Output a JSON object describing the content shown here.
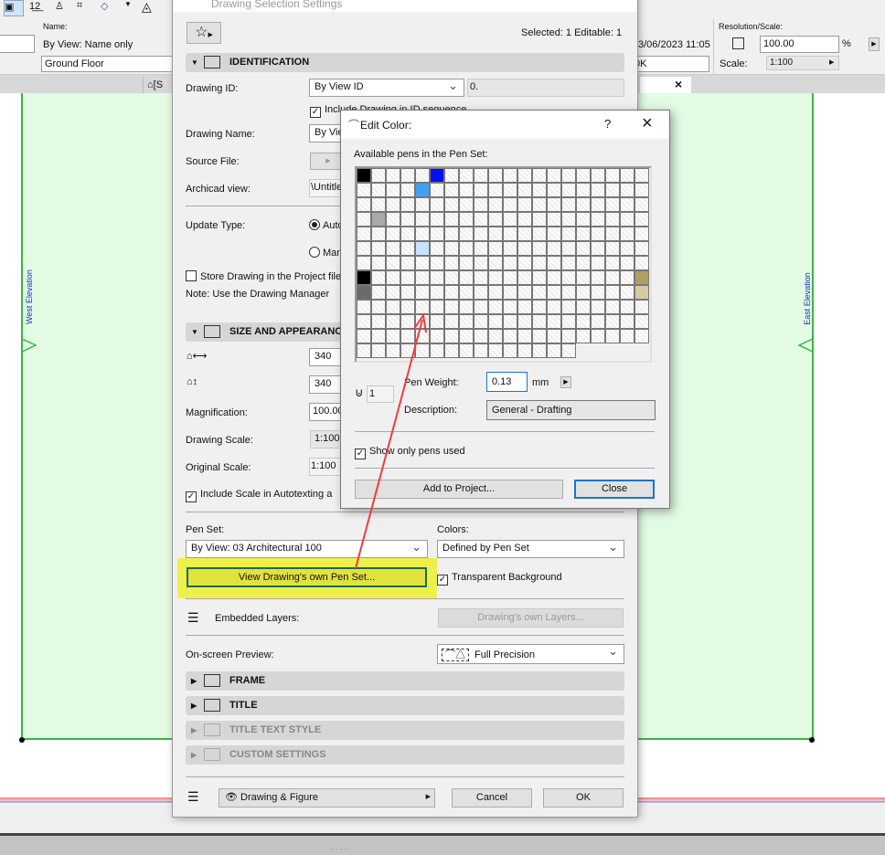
{
  "toolbar": {
    "icons": [
      "selection-icon",
      "numbering-icon",
      "figure-icon",
      "drawing-icon",
      "fill-icon",
      "dropdown-icon",
      "circle-icon"
    ]
  },
  "infobox": {
    "name_label": "Name:",
    "name_value": "By View: Name only",
    "layer_value": "Ground Floor",
    "date_value": "3/06/2023 11:05",
    "status_value": "0K",
    "resolution_label": "Resolution/Scale:",
    "resolution_value": "100.00",
    "percent": "%",
    "scale_label": "Scale:",
    "scale_value": "1:100"
  },
  "tabs": {
    "tab1": "[S",
    "close": "×"
  },
  "canvas": {
    "west_label": "West Elevation",
    "east_label": "East Elevation",
    "fill_color": "#e3fbe3",
    "border_color": "#3cb44b"
  },
  "dialog": {
    "title": "Drawing Selection Settings",
    "selected_info": "Selected: 1 Editable: 1",
    "identification": {
      "title": "IDENTIFICATION",
      "drawing_id_label": "Drawing ID:",
      "drawing_id_value": "By View ID",
      "drawing_id_text": "0.",
      "include_seq": "Include Drawing in ID sequence",
      "drawing_name_label": "Drawing Name:",
      "drawing_name_value": "By View",
      "source_file_label": "Source File:",
      "archicad_view_label": "Archicad view:",
      "archicad_view_value": "\\Untitled",
      "update_type_label": "Update Type:",
      "update_auto": "Auto",
      "update_manual": "Manual",
      "store_label": "Store Drawing in the Project file",
      "note": "Note: Use the Drawing Manager"
    },
    "size": {
      "title": "SIZE AND APPEARANCE",
      "width_value": "340",
      "height_value": "340",
      "magnification_label": "Magnification:",
      "magnification_value": "100.00",
      "drawing_scale_label": "Drawing Scale:",
      "drawing_scale_value": "1:100",
      "original_scale_label": "Original Scale:",
      "original_scale_value": "1:100",
      "include_scale": "Include Scale in Autotexting a"
    },
    "pen_set_label": "Pen Set:",
    "pen_set_value": "By View: 03 Architectural 100",
    "colors_label": "Colors:",
    "colors_value": "Defined by Pen Set",
    "view_pen_set_button": "View Drawing's own Pen Set...",
    "transparent_bg": "Transparent Background",
    "embedded_layers_label": "Embedded Layers:",
    "own_layers_button": "Drawing's own Layers...",
    "preview_label": "On-screen Preview:",
    "preview_value": "Full Precision",
    "sections": [
      "FRAME",
      "TITLE",
      "TITLE TEXT STYLE",
      "CUSTOM SETTINGS"
    ],
    "footer": {
      "layer_mode": "Drawing & Figure",
      "cancel": "Cancel",
      "ok": "OK"
    }
  },
  "edit_color": {
    "title": "Edit Color:",
    "help": "?",
    "close_x": "×",
    "available_label": "Available pens in the Pen Set:",
    "grid_columns": 20,
    "grid_count": 255,
    "colored_pens": [
      {
        "index": 0,
        "color": "#000000"
      },
      {
        "index": 5,
        "color": "#0010f0"
      },
      {
        "index": 24,
        "color": "#3fa0f5"
      },
      {
        "index": 61,
        "color": "#aaaaaa"
      },
      {
        "index": 104,
        "color": "#c8e2fa"
      },
      {
        "index": 140,
        "color": "#000000"
      },
      {
        "index": 159,
        "color": "#b0a060"
      },
      {
        "index": 160,
        "color": "#6b6b6b"
      },
      {
        "index": 179,
        "color": "#d4cba5"
      }
    ],
    "pen_number": "1",
    "pen_weight_label": "Pen Weight:",
    "pen_weight_value": "0.13",
    "unit": "mm",
    "description_label": "Description:",
    "description_value": "General - Drafting",
    "show_only_used": "Show only pens used",
    "add_button": "Add to Project...",
    "close_button": "Close"
  },
  "highlight_color": "#eef04a"
}
